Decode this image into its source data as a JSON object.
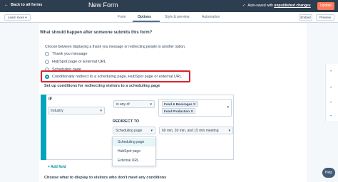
{
  "topbar": {
    "back_label": "Back to all forms",
    "title": "New Form",
    "autosave_prefix": "Auto-saved with",
    "autosave_link": "unpublished changes",
    "update_label": "Update"
  },
  "subbar": {
    "learn_more": "Learn more ▾",
    "tabs": [
      "Form",
      "Options",
      "Style & preview",
      "Automation"
    ],
    "embed_label": "Embed",
    "preview_label": "Preview"
  },
  "section": {
    "heading": "What should happen after someone submits this form?",
    "choose": "Choose between displaying a thank you message or redirecting people to another option.",
    "options": [
      "Thank you message",
      "HubSpot page or External URL",
      "Scheduling page",
      "Conditionally redirect to a scheduling page, HubSpot page or external URL"
    ],
    "selected_index": 3
  },
  "conditions": {
    "setup_label": "Set up conditions for redirecting visitors to a scheduling page",
    "if_label": "IF",
    "property": "Industry",
    "operator": "is any of",
    "tags": [
      "Food & Beverages",
      "Food Production"
    ],
    "redirect_label": "REDIRECT TO",
    "redirect_type": "Scheduling page",
    "meeting": "60 min, 30 min, and 15 min meeting",
    "dropdown_options": [
      "Scheduling page",
      "HubSpot page",
      "External URL"
    ],
    "add_field": "+ Add field"
  },
  "footer_heading": "Choose what to display to visitors who don't meet any conditions",
  "help_label": "Help",
  "colors": {
    "topbar": "#2d3e50",
    "accent": "#00a4bd",
    "highlight": "#d9232d",
    "update": "#ff7a59"
  }
}
